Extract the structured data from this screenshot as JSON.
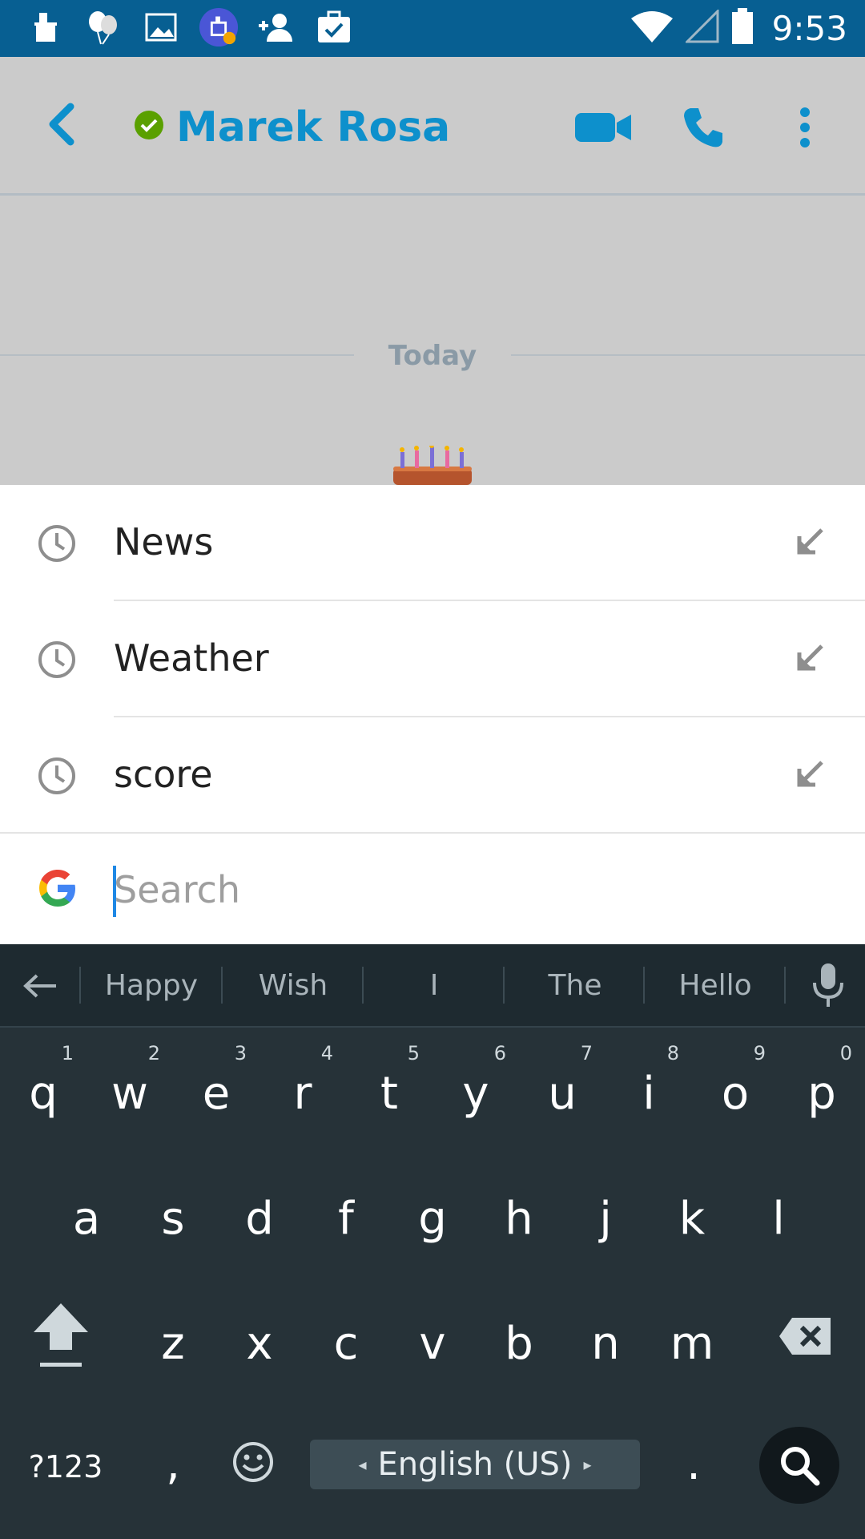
{
  "status_bar": {
    "time": "9:53",
    "left_icons": [
      "cleaner-icon",
      "balloons-icon",
      "image-icon",
      "app-notification-icon",
      "add-contact-icon",
      "task-icon"
    ],
    "right_icons": [
      "wifi-icon",
      "signal-icon",
      "battery-icon"
    ]
  },
  "header": {
    "contact_name": "Marek Rosa",
    "presence": "online"
  },
  "chat": {
    "day_label": "Today"
  },
  "suggestions": {
    "items": [
      {
        "label": "News"
      },
      {
        "label": "Weather"
      },
      {
        "label": "score"
      }
    ],
    "search_placeholder": "Search",
    "search_value": ""
  },
  "keyboard": {
    "word_suggestions": [
      "Happy",
      "Wish",
      "I",
      "The",
      "Hello"
    ],
    "row1": [
      {
        "key": "q",
        "hint": "1"
      },
      {
        "key": "w",
        "hint": "2"
      },
      {
        "key": "e",
        "hint": "3"
      },
      {
        "key": "r",
        "hint": "4"
      },
      {
        "key": "t",
        "hint": "5"
      },
      {
        "key": "y",
        "hint": "6"
      },
      {
        "key": "u",
        "hint": "7"
      },
      {
        "key": "i",
        "hint": "8"
      },
      {
        "key": "o",
        "hint": "9"
      },
      {
        "key": "p",
        "hint": "0"
      }
    ],
    "row2": [
      "a",
      "s",
      "d",
      "f",
      "g",
      "h",
      "j",
      "k",
      "l"
    ],
    "row3": [
      "z",
      "x",
      "c",
      "v",
      "b",
      "n",
      "m"
    ],
    "symbols_label": "?123",
    "comma": ",",
    "period": ".",
    "space_label": "English (US)"
  },
  "colors": {
    "status_bar": "#075f92",
    "accent": "#0d90cc",
    "presence_green": "#5aa000",
    "keyboard_bg": "#263238"
  }
}
